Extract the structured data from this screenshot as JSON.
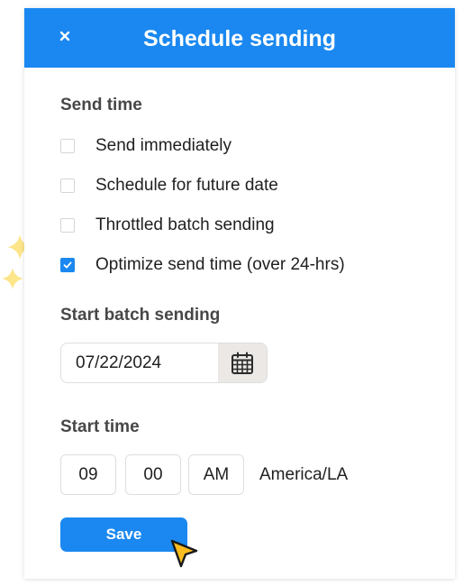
{
  "dialog": {
    "title": "Schedule sending",
    "close_icon": "close-icon"
  },
  "send_time": {
    "label": "Send time",
    "options": [
      {
        "label": "Send immediately",
        "checked": false
      },
      {
        "label": "Schedule for future date",
        "checked": false
      },
      {
        "label": "Throttled batch sending",
        "checked": false
      },
      {
        "label": "Optimize send time (over 24-hrs)",
        "checked": true
      }
    ]
  },
  "start_batch": {
    "label": "Start batch sending",
    "date_value": "07/22/2024",
    "calendar_icon": "calendar-icon"
  },
  "start_time": {
    "label": "Start time",
    "hour": "09",
    "minute": "00",
    "period": "AM",
    "timezone": "America/LA"
  },
  "actions": {
    "save_label": "Save"
  },
  "colors": {
    "accent": "#1a88f0",
    "sparkle": "#fbbc20",
    "text": "#1f1f1f",
    "label": "#474747"
  }
}
